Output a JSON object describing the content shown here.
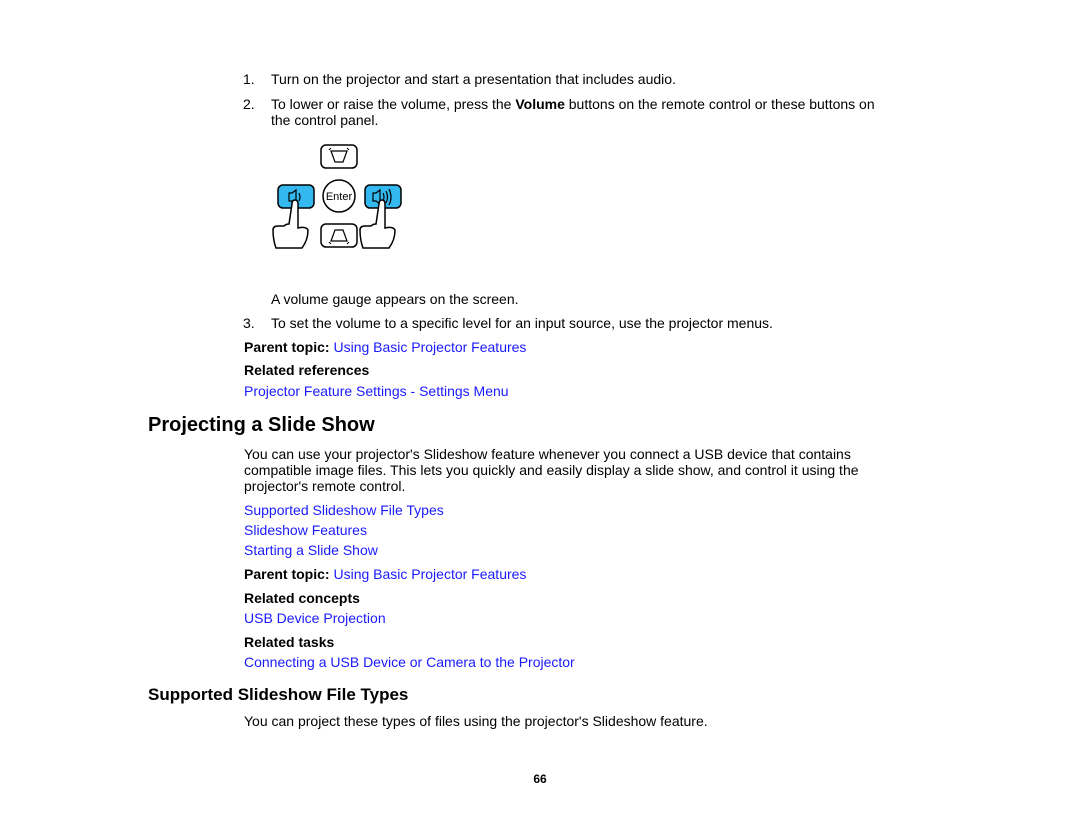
{
  "steps": [
    {
      "number": "1.",
      "text": "Turn on the projector and start a presentation that includes audio."
    },
    {
      "number": "2.",
      "text_before": "To lower or raise the volume, press the ",
      "bold": "Volume",
      "text_after": " buttons on the remote control or these buttons on",
      "text_line2": "the control panel."
    },
    {
      "number": "3.",
      "text": "To set the volume to a specific level for an input source, use the projector menus."
    }
  ],
  "illustration": {
    "enter_label": "Enter",
    "accent_color": "#33b8f0",
    "buttons": [
      "keystone-up-icon",
      "volume-down-icon",
      "enter-button",
      "volume-up-icon",
      "keystone-down-icon"
    ]
  },
  "result_text": "A volume gauge appears on the screen.",
  "section1": {
    "parent_topic_label": "Parent topic:",
    "parent_topic_link": "Using Basic Projector Features",
    "related_references_label": "Related references",
    "related_references_links": [
      "Projector Feature Settings - Settings Menu"
    ]
  },
  "section2": {
    "title": "Projecting a Slide Show",
    "intro_lines": [
      "You can use your projector's Slideshow feature whenever you connect a USB device that contains",
      "compatible image files. This lets you quickly and easily display a slide show, and control it using the",
      "projector's remote control."
    ],
    "child_links": [
      "Supported Slideshow File Types",
      "Slideshow Features",
      "Starting a Slide Show"
    ],
    "parent_topic_label": "Parent topic:",
    "parent_topic_link": "Using Basic Projector Features",
    "related_concepts_label": "Related concepts",
    "related_concepts_links": [
      "USB Device Projection"
    ],
    "related_tasks_label": "Related tasks",
    "related_tasks_links": [
      "Connecting a USB Device or Camera to the Projector"
    ]
  },
  "section3": {
    "title": "Supported Slideshow File Types",
    "intro": "You can project these types of files using the projector's Slideshow feature."
  },
  "page_number": "66",
  "colors": {
    "link": "#1a1aff",
    "text": "#000000",
    "button_fill": "#33b8f0"
  }
}
